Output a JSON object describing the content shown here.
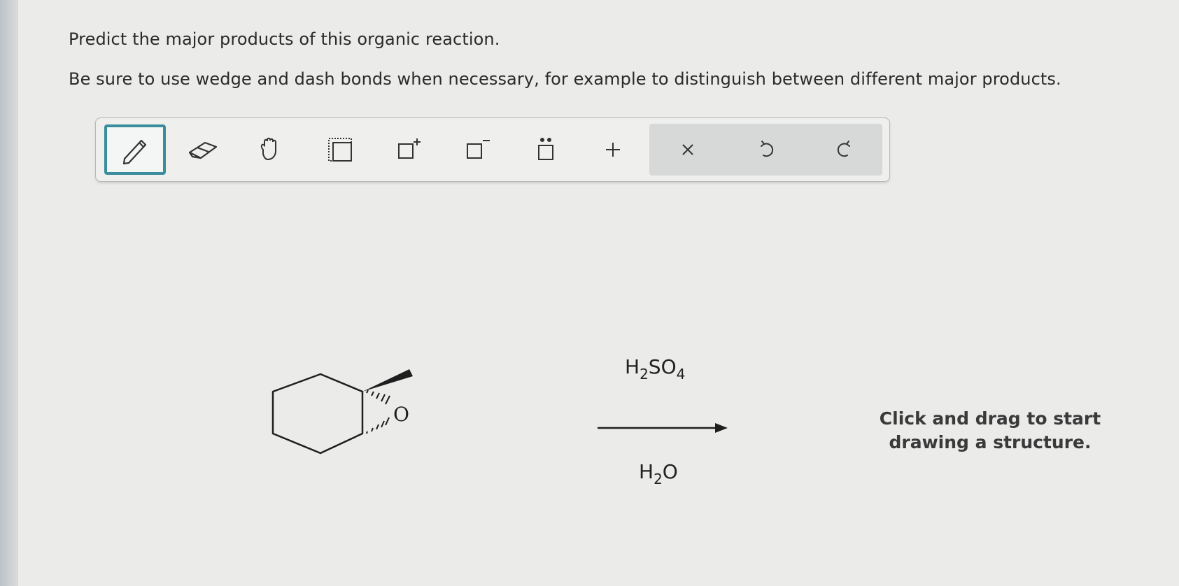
{
  "prompt": {
    "line1": "Predict the major products of this organic reaction.",
    "line2": "Be sure to use wedge and dash bonds when necessary, for example to distinguish between different major products."
  },
  "toolbar": {
    "tools": [
      {
        "icon": "pencil-icon",
        "selected": true
      },
      {
        "icon": "eraser-icon"
      },
      {
        "icon": "hand-icon"
      },
      {
        "icon": "select-box-icon"
      },
      {
        "icon": "positive-charge-icon"
      },
      {
        "icon": "negative-charge-icon"
      },
      {
        "icon": "lone-pair-icon"
      },
      {
        "icon": "add-arrow-icon"
      }
    ],
    "actions": [
      {
        "icon": "close-icon"
      },
      {
        "icon": "undo-icon"
      },
      {
        "icon": "redo-icon"
      }
    ],
    "accent_color": "#3a8d9c"
  },
  "reaction": {
    "reactant_atom_label": "O",
    "reagent_top": {
      "main": "H",
      "sub1": "2",
      "main2": "SO",
      "sub2": "4"
    },
    "reagent_bottom": {
      "main": "H",
      "sub1": "2",
      "main2": "O"
    }
  },
  "canvas": {
    "hint": "Click and drag to start drawing a structure."
  }
}
